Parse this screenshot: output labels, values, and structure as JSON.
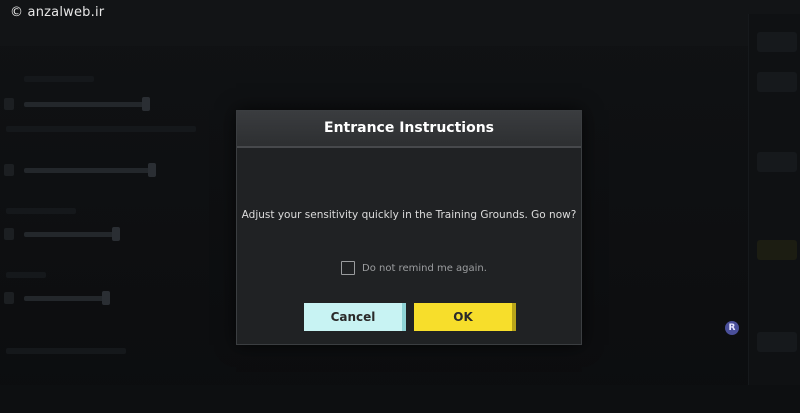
{
  "watermark": {
    "text": "© anzalweb.ir"
  },
  "dialog": {
    "title": "Entrance Instructions",
    "message": "Adjust your sensitivity quickly in the Training Grounds. Go now?",
    "remind_checkbox": {
      "label": "Do not remind me again.",
      "checked": false
    },
    "buttons": {
      "cancel_label": "Cancel",
      "ok_label": "OK"
    }
  },
  "badge": {
    "text": "R"
  },
  "colors": {
    "dialog_bg": "#202224",
    "header_bg": "#2d2f31",
    "cancel_button": "#c8f3f3",
    "ok_button": "#f7de2b",
    "badge": "#4a4f9a"
  }
}
